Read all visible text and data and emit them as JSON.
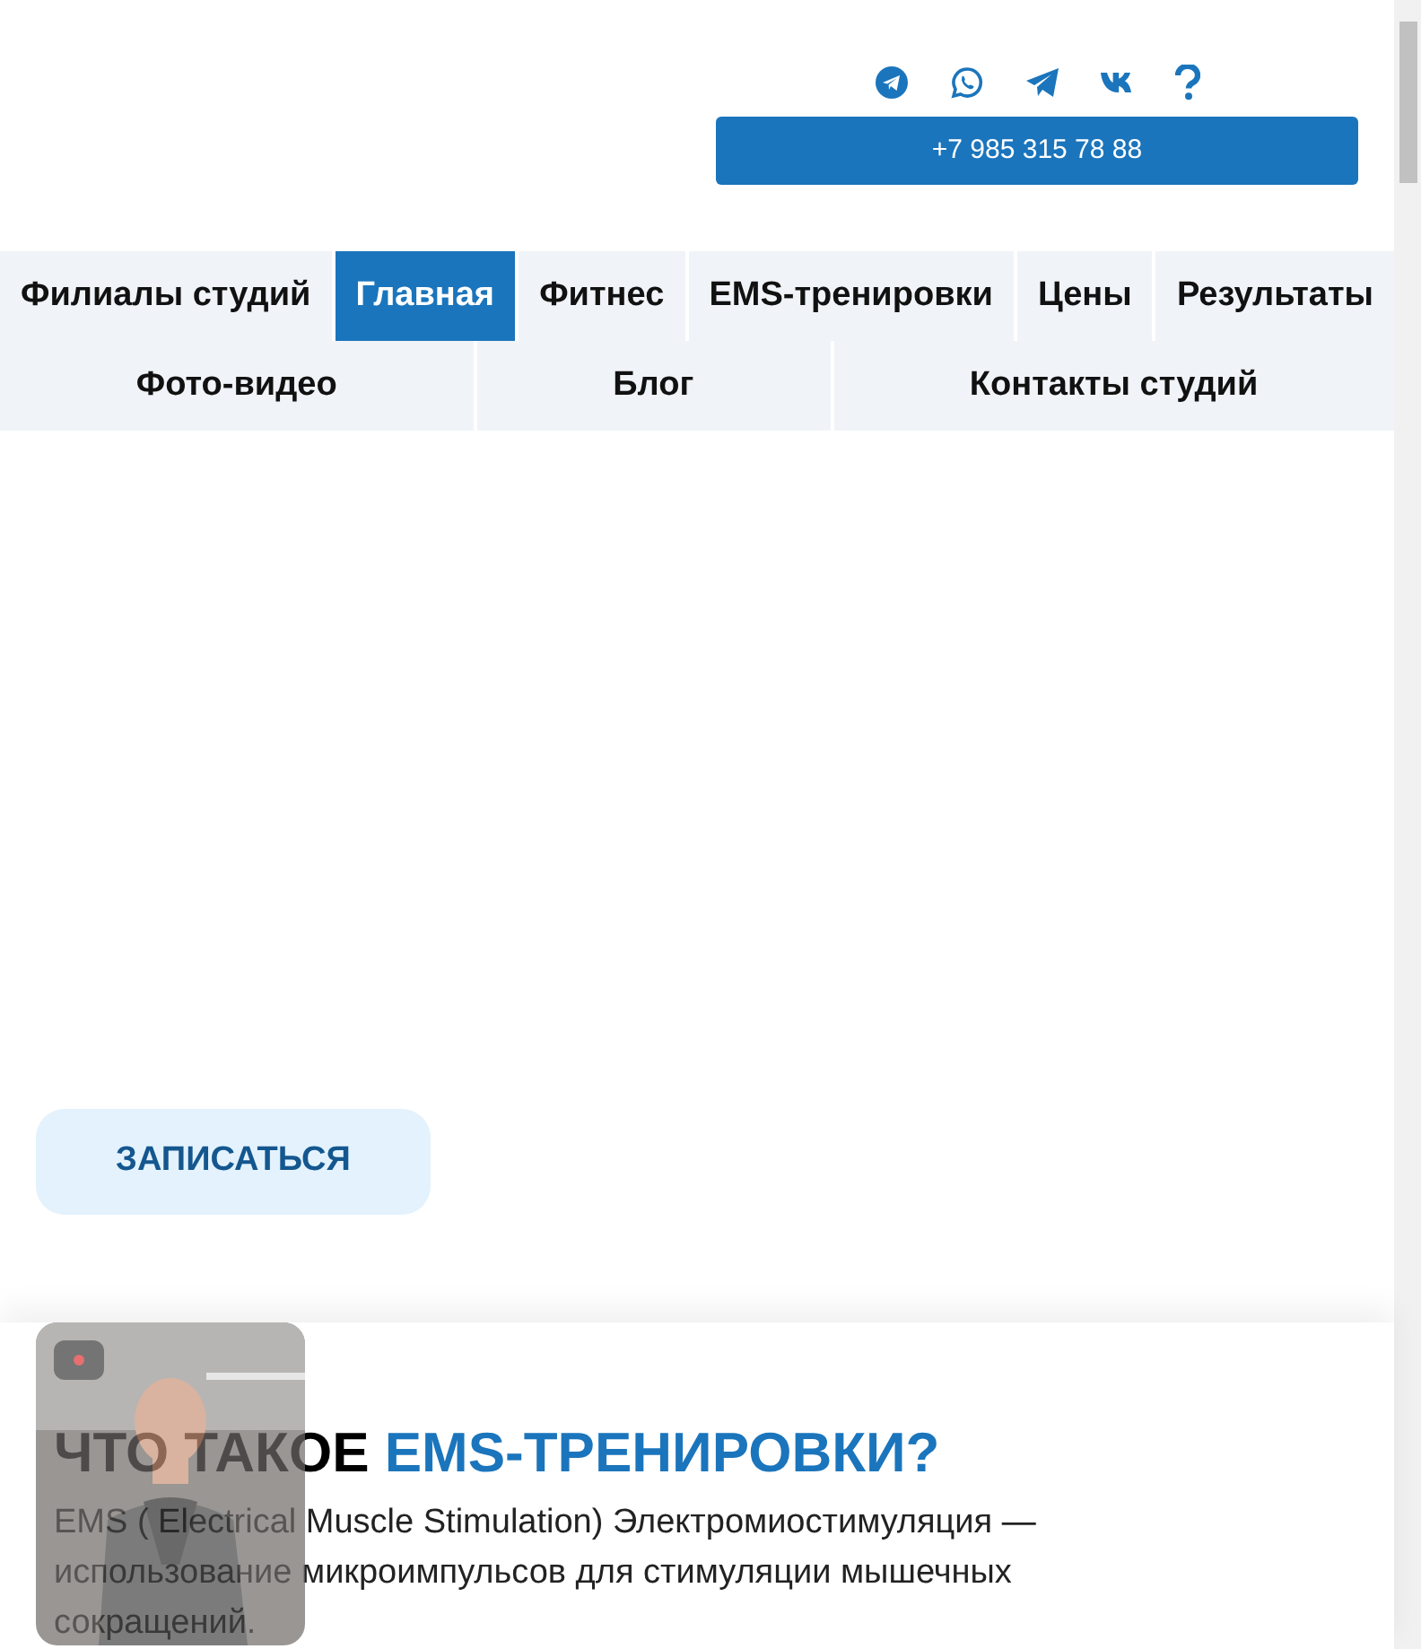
{
  "header": {
    "social_links": [
      {
        "kind": "telegram-circle"
      },
      {
        "kind": "whatsapp"
      },
      {
        "kind": "telegram"
      },
      {
        "kind": "vk"
      },
      {
        "kind": "question"
      }
    ],
    "phone": "+7 985 315 78 88"
  },
  "nav": {
    "items": [
      {
        "label": "Филиалы студий",
        "selected": false
      },
      {
        "label": "Главная",
        "selected": true
      },
      {
        "label": "Фитнес",
        "selected": false
      },
      {
        "label": "EMS-тренировки",
        "selected": false
      },
      {
        "label": "Цены",
        "selected": false
      },
      {
        "label": "Результаты",
        "selected": false
      },
      {
        "label": "Фото-видео",
        "selected": false
      },
      {
        "label": "Блог",
        "selected": false
      },
      {
        "label": "Контакты студий",
        "selected": false
      }
    ]
  },
  "hero": {
    "cta": "ЗАПИСАТЬСЯ"
  },
  "section": {
    "title": "ЧТО ТАКОЕ **EMS-ТРЕНИРОВКИ?**",
    "text": "EMS ( Electrical Muscle Stimulation) Электромиостимуляция — использование микроимпульсов для стимуляции мышечных сокращений."
  }
}
